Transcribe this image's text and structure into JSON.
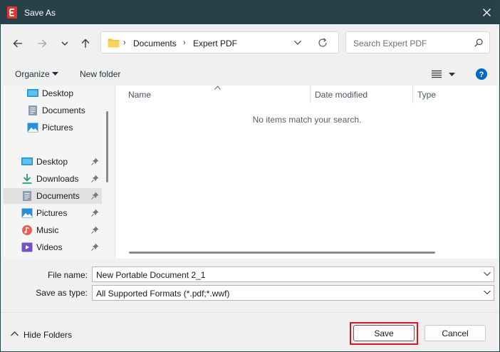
{
  "window": {
    "title": "Save As"
  },
  "address": {
    "crumbs": [
      "Documents",
      "Expert PDF"
    ],
    "separator": "›"
  },
  "search": {
    "placeholder": "Search Expert PDF"
  },
  "toolbar": {
    "organize_label": "Organize",
    "new_folder_label": "New folder"
  },
  "nav": {
    "quick_items": [
      {
        "label": "Desktop",
        "icon": "desktop-icon"
      },
      {
        "label": "Documents",
        "icon": "documents-icon"
      },
      {
        "label": "Pictures",
        "icon": "pictures-icon"
      }
    ],
    "pinned_items": [
      {
        "label": "Desktop",
        "icon": "desktop-icon",
        "pinned": true
      },
      {
        "label": "Downloads",
        "icon": "downloads-icon",
        "pinned": true
      },
      {
        "label": "Documents",
        "icon": "documents-icon",
        "pinned": true,
        "selected": true
      },
      {
        "label": "Pictures",
        "icon": "pictures-icon",
        "pinned": true
      },
      {
        "label": "Music",
        "icon": "music-icon",
        "pinned": true
      },
      {
        "label": "Videos",
        "icon": "videos-icon",
        "pinned": true
      }
    ]
  },
  "filelist": {
    "columns": [
      "Name",
      "Date modified",
      "Type"
    ],
    "empty_message": "No items match your search."
  },
  "form": {
    "filename_label": "File name:",
    "filename_value": "New Portable Document 2_1",
    "savetype_label": "Save as type:",
    "savetype_value": "All Supported Formats (*.pdf;*.wwf)"
  },
  "footer": {
    "hide_folders_label": "Hide Folders",
    "save_label": "Save",
    "cancel_label": "Cancel"
  },
  "colors": {
    "titlebar": "#284049",
    "highlight": "#d9141e",
    "accent": "#0067c0",
    "app_icon": "#e5322d"
  }
}
